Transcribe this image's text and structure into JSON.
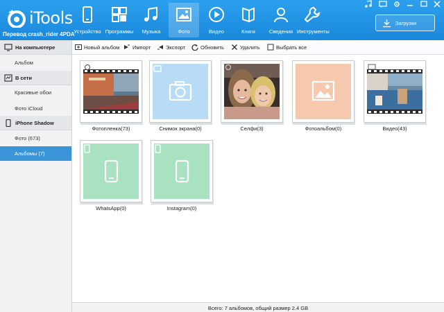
{
  "app": {
    "name": "iTools",
    "subtitle": "Перевод crash_rider 4PDA"
  },
  "nav": [
    {
      "label": "Устройство",
      "icon": "phone-icon"
    },
    {
      "label": "Программы",
      "icon": "apps-icon"
    },
    {
      "label": "Музыка",
      "icon": "music-icon"
    },
    {
      "label": "Фото",
      "icon": "photo-icon",
      "active": true
    },
    {
      "label": "Видео",
      "icon": "play-icon"
    },
    {
      "label": "Книги",
      "icon": "book-icon"
    },
    {
      "label": "Сведения",
      "icon": "person-icon"
    },
    {
      "label": "Инструменты",
      "icon": "wrench-icon"
    }
  ],
  "downloads_label": "Загрузки",
  "toolbar": {
    "new_album": "Новый альбом",
    "import": "Импорт",
    "export": "Экспорт",
    "refresh": "Обновить",
    "delete": "Удалить",
    "select_all": "Выбрать все"
  },
  "sidebar": {
    "computer_header": "На компьютере",
    "computer_items": [
      "Альбом"
    ],
    "online_header": "В сети",
    "online_items": [
      "Красивые обои",
      "Фото iCloud"
    ],
    "device_header": "iPhone Shadow",
    "device_items": [
      "Фото (673)",
      "Альбомы (7)"
    ]
  },
  "albums": [
    {
      "name": "Фотопленка(73)",
      "kind": "photo-strip"
    },
    {
      "name": "Снимок экрана(0)",
      "kind": "camera",
      "color": "#b8dcf6"
    },
    {
      "name": "Селфи(3)",
      "kind": "selfie-photo"
    },
    {
      "name": "Фотоальбом(0)",
      "kind": "picture",
      "color": "#f6c8ae"
    },
    {
      "name": "Видео(43)",
      "kind": "video-strip"
    },
    {
      "name": "WhatsApp(0)",
      "kind": "phone",
      "color": "#a8e2c0"
    },
    {
      "name": "Instagram(0)",
      "kind": "phone",
      "color": "#a8e2c0"
    }
  ],
  "status": "Всего: 7 альбомов, общий размер 2.4 GB",
  "colors": {
    "topbar": "#1f93e4",
    "selected": "#3a94d8"
  }
}
